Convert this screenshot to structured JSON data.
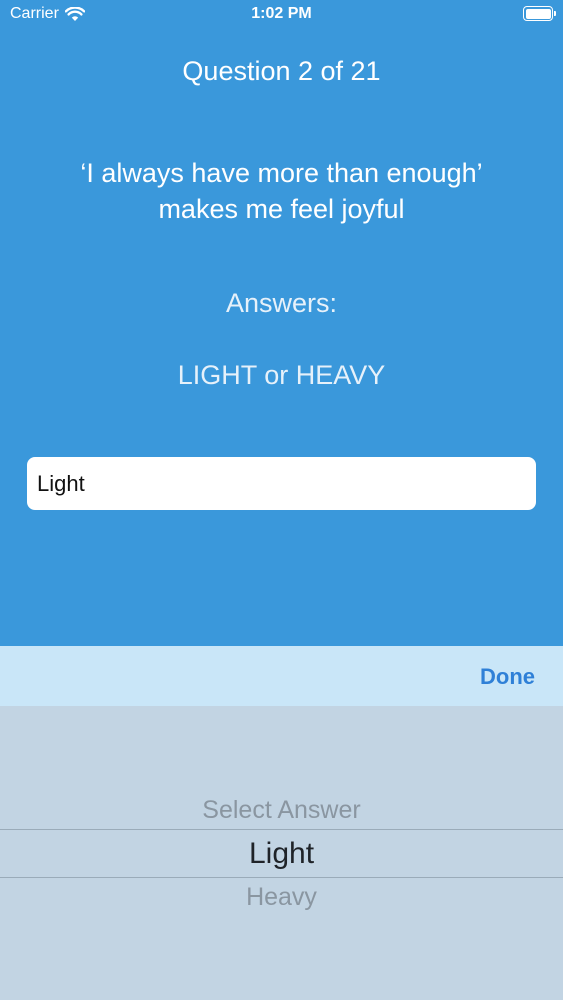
{
  "status_bar": {
    "carrier": "Carrier",
    "time": "1:02 PM",
    "icons": [
      "wifi-icon",
      "battery-icon"
    ]
  },
  "quiz": {
    "question_number": "Question 2 of 21",
    "question_line1": "‘I always have more than enough’",
    "question_line2": "makes me feel joyful",
    "answers_label": "Answers:",
    "answer_options": "LIGHT or HEAVY"
  },
  "answer_field": {
    "value": "Light"
  },
  "toolbar": {
    "done_label": "Done"
  },
  "picker": {
    "options": [
      "Select Answer",
      "Light",
      "Heavy"
    ],
    "selected": "Light"
  },
  "colors": {
    "background": "#3a98db",
    "toolbar": "#c9e6f8",
    "picker": "#c2d4e3",
    "accent": "#2f80d7"
  }
}
